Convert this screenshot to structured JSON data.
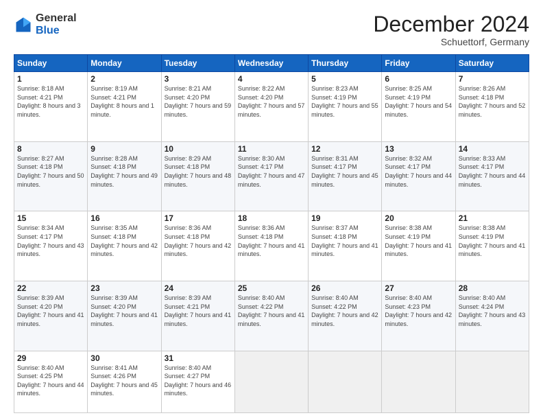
{
  "logo": {
    "general": "General",
    "blue": "Blue"
  },
  "header": {
    "month": "December 2024",
    "location": "Schuettorf, Germany"
  },
  "days_of_week": [
    "Sunday",
    "Monday",
    "Tuesday",
    "Wednesday",
    "Thursday",
    "Friday",
    "Saturday"
  ],
  "weeks": [
    [
      {
        "day": "1",
        "sunrise": "Sunrise: 8:18 AM",
        "sunset": "Sunset: 4:21 PM",
        "daylight": "Daylight: 8 hours and 3 minutes."
      },
      {
        "day": "2",
        "sunrise": "Sunrise: 8:19 AM",
        "sunset": "Sunset: 4:21 PM",
        "daylight": "Daylight: 8 hours and 1 minute."
      },
      {
        "day": "3",
        "sunrise": "Sunrise: 8:21 AM",
        "sunset": "Sunset: 4:20 PM",
        "daylight": "Daylight: 7 hours and 59 minutes."
      },
      {
        "day": "4",
        "sunrise": "Sunrise: 8:22 AM",
        "sunset": "Sunset: 4:20 PM",
        "daylight": "Daylight: 7 hours and 57 minutes."
      },
      {
        "day": "5",
        "sunrise": "Sunrise: 8:23 AM",
        "sunset": "Sunset: 4:19 PM",
        "daylight": "Daylight: 7 hours and 55 minutes."
      },
      {
        "day": "6",
        "sunrise": "Sunrise: 8:25 AM",
        "sunset": "Sunset: 4:19 PM",
        "daylight": "Daylight: 7 hours and 54 minutes."
      },
      {
        "day": "7",
        "sunrise": "Sunrise: 8:26 AM",
        "sunset": "Sunset: 4:18 PM",
        "daylight": "Daylight: 7 hours and 52 minutes."
      }
    ],
    [
      {
        "day": "8",
        "sunrise": "Sunrise: 8:27 AM",
        "sunset": "Sunset: 4:18 PM",
        "daylight": "Daylight: 7 hours and 50 minutes."
      },
      {
        "day": "9",
        "sunrise": "Sunrise: 8:28 AM",
        "sunset": "Sunset: 4:18 PM",
        "daylight": "Daylight: 7 hours and 49 minutes."
      },
      {
        "day": "10",
        "sunrise": "Sunrise: 8:29 AM",
        "sunset": "Sunset: 4:18 PM",
        "daylight": "Daylight: 7 hours and 48 minutes."
      },
      {
        "day": "11",
        "sunrise": "Sunrise: 8:30 AM",
        "sunset": "Sunset: 4:17 PM",
        "daylight": "Daylight: 7 hours and 47 minutes."
      },
      {
        "day": "12",
        "sunrise": "Sunrise: 8:31 AM",
        "sunset": "Sunset: 4:17 PM",
        "daylight": "Daylight: 7 hours and 45 minutes."
      },
      {
        "day": "13",
        "sunrise": "Sunrise: 8:32 AM",
        "sunset": "Sunset: 4:17 PM",
        "daylight": "Daylight: 7 hours and 44 minutes."
      },
      {
        "day": "14",
        "sunrise": "Sunrise: 8:33 AM",
        "sunset": "Sunset: 4:17 PM",
        "daylight": "Daylight: 7 hours and 44 minutes."
      }
    ],
    [
      {
        "day": "15",
        "sunrise": "Sunrise: 8:34 AM",
        "sunset": "Sunset: 4:17 PM",
        "daylight": "Daylight: 7 hours and 43 minutes."
      },
      {
        "day": "16",
        "sunrise": "Sunrise: 8:35 AM",
        "sunset": "Sunset: 4:18 PM",
        "daylight": "Daylight: 7 hours and 42 minutes."
      },
      {
        "day": "17",
        "sunrise": "Sunrise: 8:36 AM",
        "sunset": "Sunset: 4:18 PM",
        "daylight": "Daylight: 7 hours and 42 minutes."
      },
      {
        "day": "18",
        "sunrise": "Sunrise: 8:36 AM",
        "sunset": "Sunset: 4:18 PM",
        "daylight": "Daylight: 7 hours and 41 minutes."
      },
      {
        "day": "19",
        "sunrise": "Sunrise: 8:37 AM",
        "sunset": "Sunset: 4:18 PM",
        "daylight": "Daylight: 7 hours and 41 minutes."
      },
      {
        "day": "20",
        "sunrise": "Sunrise: 8:38 AM",
        "sunset": "Sunset: 4:19 PM",
        "daylight": "Daylight: 7 hours and 41 minutes."
      },
      {
        "day": "21",
        "sunrise": "Sunrise: 8:38 AM",
        "sunset": "Sunset: 4:19 PM",
        "daylight": "Daylight: 7 hours and 41 minutes."
      }
    ],
    [
      {
        "day": "22",
        "sunrise": "Sunrise: 8:39 AM",
        "sunset": "Sunset: 4:20 PM",
        "daylight": "Daylight: 7 hours and 41 minutes."
      },
      {
        "day": "23",
        "sunrise": "Sunrise: 8:39 AM",
        "sunset": "Sunset: 4:20 PM",
        "daylight": "Daylight: 7 hours and 41 minutes."
      },
      {
        "day": "24",
        "sunrise": "Sunrise: 8:39 AM",
        "sunset": "Sunset: 4:21 PM",
        "daylight": "Daylight: 7 hours and 41 minutes."
      },
      {
        "day": "25",
        "sunrise": "Sunrise: 8:40 AM",
        "sunset": "Sunset: 4:22 PM",
        "daylight": "Daylight: 7 hours and 41 minutes."
      },
      {
        "day": "26",
        "sunrise": "Sunrise: 8:40 AM",
        "sunset": "Sunset: 4:22 PM",
        "daylight": "Daylight: 7 hours and 42 minutes."
      },
      {
        "day": "27",
        "sunrise": "Sunrise: 8:40 AM",
        "sunset": "Sunset: 4:23 PM",
        "daylight": "Daylight: 7 hours and 42 minutes."
      },
      {
        "day": "28",
        "sunrise": "Sunrise: 8:40 AM",
        "sunset": "Sunset: 4:24 PM",
        "daylight": "Daylight: 7 hours and 43 minutes."
      }
    ],
    [
      {
        "day": "29",
        "sunrise": "Sunrise: 8:40 AM",
        "sunset": "Sunset: 4:25 PM",
        "daylight": "Daylight: 7 hours and 44 minutes."
      },
      {
        "day": "30",
        "sunrise": "Sunrise: 8:41 AM",
        "sunset": "Sunset: 4:26 PM",
        "daylight": "Daylight: 7 hours and 45 minutes."
      },
      {
        "day": "31",
        "sunrise": "Sunrise: 8:40 AM",
        "sunset": "Sunset: 4:27 PM",
        "daylight": "Daylight: 7 hours and 46 minutes."
      },
      null,
      null,
      null,
      null
    ]
  ]
}
